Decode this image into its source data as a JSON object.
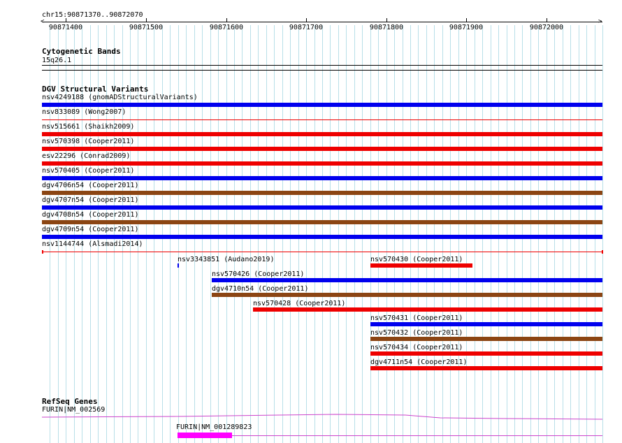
{
  "colors": {
    "blue": "#0000ee",
    "red": "#ee0000",
    "brown": "#8b4513",
    "magenta": "#ff00ff",
    "gene_line": "#cc44cc",
    "grid": "#b8dfe8"
  },
  "ruler": {
    "region": "chr15:90871370..90872070",
    "ticks": [
      {
        "label": "90871400",
        "value": 90871400
      },
      {
        "label": "90871500",
        "value": 90871500
      },
      {
        "label": "90871600",
        "value": 90871600
      },
      {
        "label": "90871700",
        "value": 90871700
      },
      {
        "label": "90871800",
        "value": 90871800
      },
      {
        "label": "90871900",
        "value": 90871900
      },
      {
        "label": "90872000",
        "value": 90872000
      }
    ]
  },
  "cytobands": {
    "title": "Cytogenetic Bands",
    "band": "15q26.1"
  },
  "dgv": {
    "title": "DGV Structural Variants",
    "rows": [
      {
        "label": "nsv4249188 (gnomADStructuralVariants)",
        "color": "blue",
        "style": "thick"
      },
      {
        "label": "nsv833089 (Wong2007)",
        "color": "red",
        "style": "thin"
      },
      {
        "label": "nsv515661 (Shaikh2009)",
        "color": "red",
        "style": "thick"
      },
      {
        "label": "nsv570398 (Cooper2011)",
        "color": "red",
        "style": "thick"
      },
      {
        "label": "esv22296 (Conrad2009)",
        "color": "red",
        "style": "thick"
      },
      {
        "label": "nsv570405 (Cooper2011)",
        "color": "blue",
        "style": "thick"
      },
      {
        "label": "dgv4706n54 (Cooper2011)",
        "color": "brown",
        "style": "thick"
      },
      {
        "label": "dgv4707n54 (Cooper2011)",
        "color": "blue",
        "style": "thick"
      },
      {
        "label": "dgv4708n54 (Cooper2011)",
        "color": "brown",
        "style": "thick"
      },
      {
        "label": "dgv4709n54 (Cooper2011)",
        "color": "blue",
        "style": "thick"
      },
      {
        "label": "nsv1144744 (Alsmadi2014)",
        "color": "red",
        "style": "thin-ends"
      }
    ],
    "partial": [
      {
        "label": "nsv3343851 (Audano2019)",
        "color": "blue",
        "start": 90871539,
        "end": 90871541
      },
      {
        "label": "nsv570430 (Cooper2011)",
        "color": "red",
        "start": 90871780,
        "end": 90871908
      },
      {
        "label": "nsv570426 (Cooper2011)",
        "color": "blue",
        "start": 90871582,
        "end": 90872070
      },
      {
        "label": "dgv4710n54 (Cooper2011)",
        "color": "brown",
        "start": 90871582,
        "end": 90872070
      },
      {
        "label": "nsv570428 (Cooper2011)",
        "color": "red",
        "start": 90871634,
        "end": 90872070
      },
      {
        "label": "nsv570431 (Cooper2011)",
        "color": "blue",
        "start": 90871780,
        "end": 90872070
      },
      {
        "label": "nsv570432 (Cooper2011)",
        "color": "brown",
        "start": 90871780,
        "end": 90872070
      },
      {
        "label": "nsv570434 (Cooper2011)",
        "color": "red",
        "start": 90871780,
        "end": 90872070
      },
      {
        "label": "dgv4711n54 (Cooper2011)",
        "color": "red",
        "start": 90871780,
        "end": 90872070
      }
    ]
  },
  "refseq": {
    "title": "RefSeq Genes",
    "gene1": {
      "label": "FURIN|NM_002569"
    },
    "gene2": {
      "label": "FURIN|NM_001289823",
      "exon_start": 90871539,
      "exon_end": 90871607
    }
  }
}
